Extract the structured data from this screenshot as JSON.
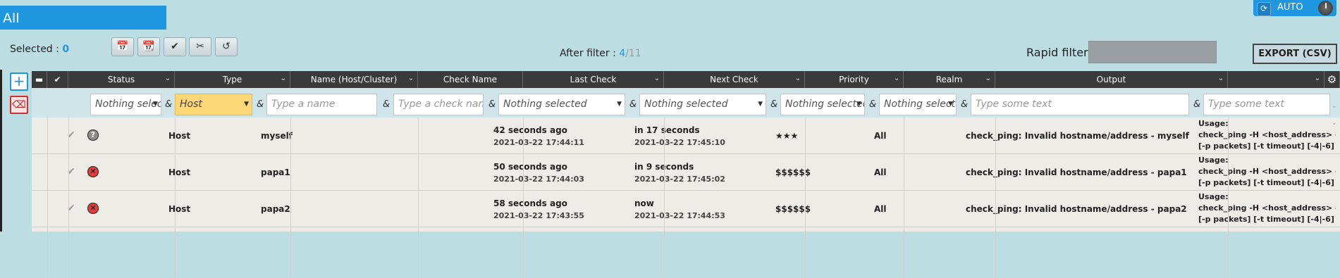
{
  "header": {
    "tab_label": "All",
    "auto_label": "AUTO",
    "selected_label": "Selected : ",
    "selected_count": "0",
    "after_filter_label": "After filter : ",
    "after_filter_shown": "4",
    "after_filter_sep": "/",
    "after_filter_total": "11",
    "rapid_filter_label": "Rapid filter",
    "export_label": "EXPORT (CSV)"
  },
  "toolbar": {
    "icons": [
      "calendar-15-icon",
      "calendar-25-icon",
      "check-circle-icon",
      "tools-icon",
      "refresh-icon"
    ]
  },
  "columns": [
    "Status",
    "Type",
    "Name (Host/Cluster)",
    "Check Name",
    "Last Check",
    "Next Check",
    "Priority",
    "Realm",
    "Output"
  ],
  "filters": {
    "status": "Nothing selec",
    "type": "Host",
    "name_placeholder": "Type a name",
    "check_name_placeholder": "Type a check name",
    "last_check": "Nothing selected",
    "next_check": "Nothing selected",
    "priority": "Nothing selected",
    "realm": "Nothing selecte",
    "output_placeholder": "Type some text",
    "extra_placeholder": "Type some text",
    "amp": "&"
  },
  "rows": [
    {
      "status": "unknown",
      "status_glyph": "?",
      "type": "Host",
      "name": "myself",
      "check_name": "",
      "last_ago": "42 seconds ago",
      "last_time": "2021-03-22 17:44:11",
      "next_in": "in 17 seconds",
      "next_time": "2021-03-22 17:45:10",
      "priority": "★★★",
      "realm": "All",
      "output": "check_ping: Invalid hostname/address - myself",
      "long1": "Usage:",
      "long2": "check_ping -H <host_address> -w <wrta>,<wpl>% -c <crta>,<cpl>%",
      "long3": "[-p packets] [-t timeout] [-4|-6]"
    },
    {
      "status": "down",
      "status_glyph": "✕",
      "type": "Host",
      "name": "papa1",
      "check_name": "",
      "last_ago": "50 seconds ago",
      "last_time": "2021-03-22 17:44:03",
      "next_in": "in 9 seconds",
      "next_time": "2021-03-22 17:45:02",
      "priority": "$$$$$$",
      "realm": "All",
      "output": "check_ping: Invalid hostname/address - papa1",
      "long1": "Usage:",
      "long2": "check_ping -H <host_address> -w <wrta>,<wpl>% -c <crta>,<cpl>%",
      "long3": "[-p packets] [-t timeout] [-4|-6]"
    },
    {
      "status": "down",
      "status_glyph": "✕",
      "type": "Host",
      "name": "papa2",
      "check_name": "",
      "last_ago": "58 seconds ago",
      "last_time": "2021-03-22 17:43:55",
      "next_in": "now",
      "next_time": "2021-03-22 17:44:53",
      "priority": "$$$$$$",
      "realm": "All",
      "output": "check_ping: Invalid hostname/address - papa2",
      "long1": "Usage:",
      "long2": "check_ping -H <host_address> -w <wrta>,<wpl>% -c <crta>,<cpl>%",
      "long3": "[-p packets] [-t timeout] [-4|-6]"
    }
  ],
  "colors": {
    "accent": "#1e96e0",
    "header_bg": "#3a3a3a",
    "page_bg": "#bcdde2",
    "type_filter_active": "#fdd776",
    "status_down": "#e03c3c",
    "status_unknown": "#8c8c8c"
  }
}
